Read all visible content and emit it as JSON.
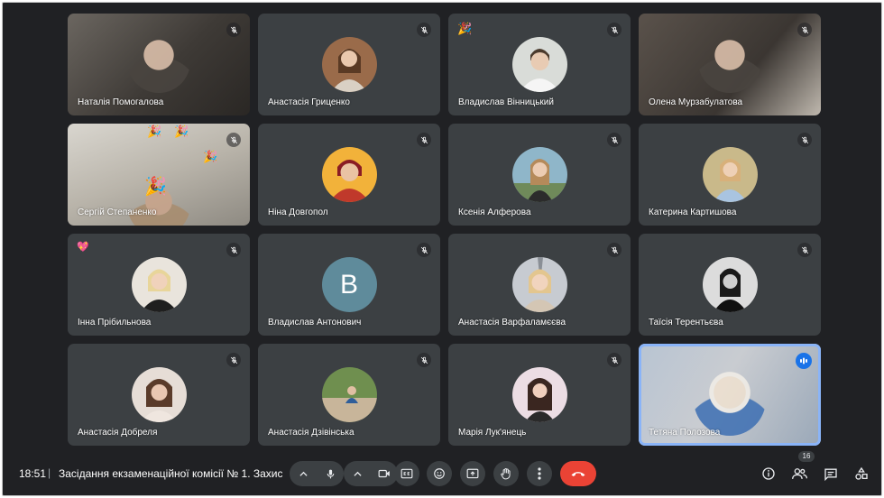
{
  "participants": [
    {
      "name": "Наталія Помогалова",
      "type": "video",
      "muted": true
    },
    {
      "name": "Анастасія Гриценко",
      "type": "photo",
      "muted": true
    },
    {
      "name": "Владислав Вінницький",
      "type": "photo",
      "muted": true,
      "reaction": "🎉"
    },
    {
      "name": "Олена Мурзабулатова",
      "type": "video",
      "muted": true
    },
    {
      "name": "Сергій Степаненко",
      "type": "video",
      "muted": true,
      "reaction": "🎉"
    },
    {
      "name": "Ніна Довгопол",
      "type": "photo",
      "muted": true
    },
    {
      "name": "Ксенія Алферова",
      "type": "photo",
      "muted": true
    },
    {
      "name": "Катерина Картишова",
      "type": "photo",
      "muted": true
    },
    {
      "name": "Інна Прібильнова",
      "type": "photo",
      "muted": true,
      "reaction": "💖"
    },
    {
      "name": "Владислав Антонович",
      "type": "letter",
      "letter": "В",
      "muted": true
    },
    {
      "name": "Анастасія Варфаламєєва",
      "type": "photo",
      "muted": true
    },
    {
      "name": "Таїсія Терентьєва",
      "type": "photo",
      "muted": true
    },
    {
      "name": "Анастасія Добреля",
      "type": "photo",
      "muted": true
    },
    {
      "name": "Анастасія Дзівінська",
      "type": "photo",
      "muted": true
    },
    {
      "name": "Марія Лук'янець",
      "type": "photo",
      "muted": true
    },
    {
      "name": "Тетяна Полозова",
      "type": "video",
      "muted": false,
      "speaking": true
    }
  ],
  "bottombar": {
    "time": "18:51",
    "separator": "|",
    "title": "Засідання екзаменаційної комісії № 1. Захист",
    "participant_count": "16"
  },
  "icons": {
    "mic": "mic-icon",
    "camera": "camera-icon",
    "captions": "captions-icon",
    "emoji": "emoji-icon",
    "present": "present-screen-icon",
    "hand": "raise-hand-icon",
    "more": "more-options-icon",
    "hangup": "hang-up-icon",
    "info": "info-icon",
    "people": "people-icon",
    "chat": "chat-icon",
    "activities": "activities-icon"
  },
  "colors": {
    "background": "#202124",
    "tile": "#3c4043",
    "hangup": "#ea4335",
    "speaking_outline": "#8ab4f8",
    "avatar_letter_bg": "#5f8b9b"
  }
}
